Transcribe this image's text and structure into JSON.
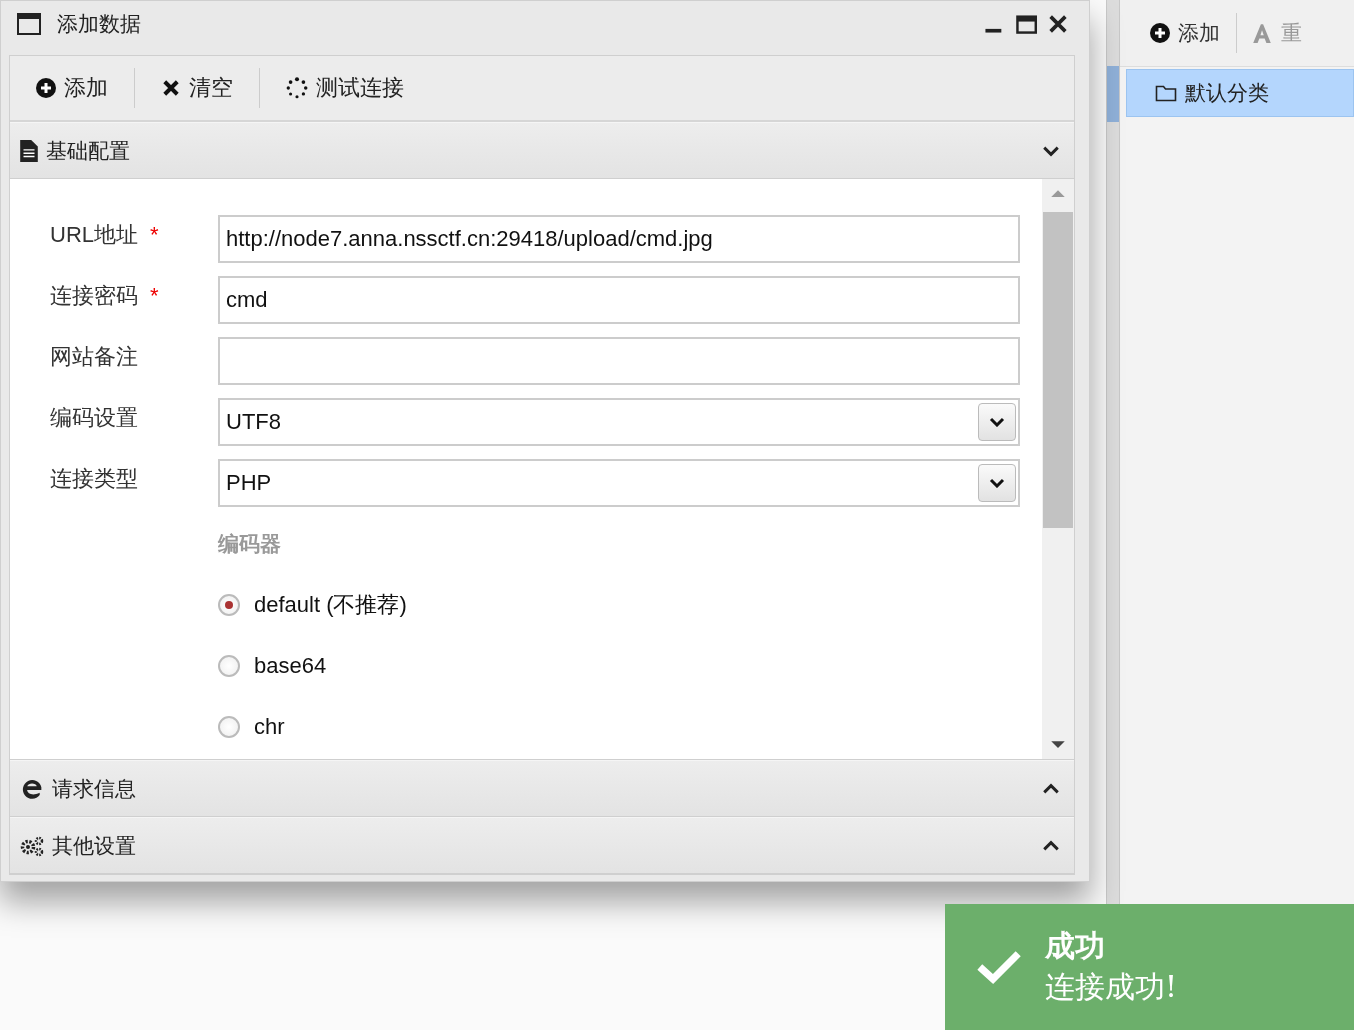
{
  "window": {
    "title": "添加数据"
  },
  "toolbar": [
    {
      "kind": "add",
      "label": "添加"
    },
    {
      "kind": "clear",
      "label": "清空"
    },
    {
      "kind": "test",
      "label": "测试连接"
    }
  ],
  "sections": [
    {
      "kind": "file",
      "title": "基础配置",
      "expanded": true
    },
    {
      "kind": "browser",
      "title": "请求信息",
      "expanded": false
    },
    {
      "kind": "gears",
      "title": "其他设置",
      "expanded": false
    }
  ],
  "form": {
    "fields": [
      {
        "label": "URL地址",
        "mark": "*",
        "kind": "text",
        "value": "http://node7.anna.nssctf.cn:29418/upload/cmd.jpg"
      },
      {
        "label": "连接密码",
        "mark": "*",
        "kind": "text",
        "value": "cmd"
      },
      {
        "label": "网站备注",
        "kind": "text"
      },
      {
        "label": "编码设置",
        "kind": "select",
        "value": "UTF8"
      },
      {
        "label": "连接类型",
        "kind": "select",
        "value": "PHP"
      }
    ],
    "encoder": {
      "label": "编码器",
      "options": [
        {
          "label": "default (不推荐)",
          "selected": true
        },
        {
          "label": "base64",
          "selected": false
        },
        {
          "label": "chr",
          "selected": false
        }
      ]
    }
  },
  "side_panel": {
    "toolbar": [
      {
        "kind": "add",
        "label": "添加"
      },
      {
        "kind": "rename",
        "label": "重"
      }
    ],
    "items": [
      {
        "label": "默认分类",
        "selected": true
      }
    ]
  },
  "toast": {
    "title": "成功",
    "message": "连接成功!"
  }
}
